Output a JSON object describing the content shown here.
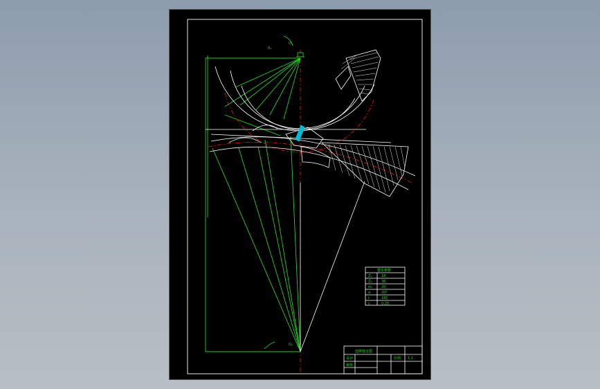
{
  "drawing": {
    "point_labels": {
      "top_center": "O₁",
      "bottom_center": "O₂",
      "top_radius": "R₁"
    },
    "parameter_table": {
      "title": "基本参数",
      "rows": [
        [
          "Z₁",
          "18"
        ],
        [
          "Z₂",
          "36"
        ],
        [
          "m",
          "20"
        ],
        [
          "α",
          "20°"
        ],
        [
          "r",
          "180"
        ],
        [
          "c",
          "0.25"
        ]
      ]
    },
    "title_block": {
      "title": "齿廓啮合图",
      "cells": [
        "设计",
        "审核",
        "比例",
        "1:1"
      ]
    },
    "colors": {
      "outline": "#1fd21f",
      "center_line": "#e01010",
      "profile": "#ffffff",
      "highlight": "#00bcd4"
    }
  }
}
